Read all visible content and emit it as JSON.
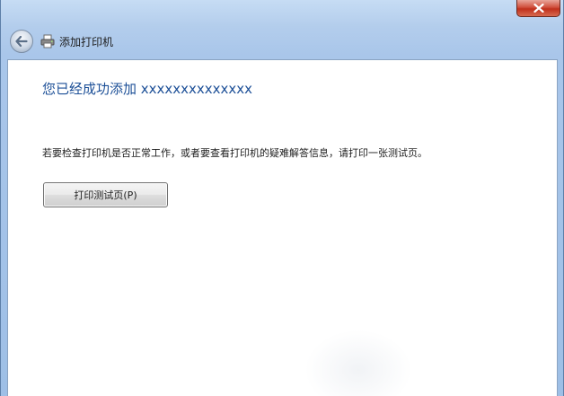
{
  "window": {
    "close_icon": "close-x-icon"
  },
  "nav": {
    "back_icon": "back-arrow-icon",
    "app_icon": "printer-icon",
    "title": "添加打印机"
  },
  "main": {
    "heading": "您已经成功添加 xxxxxxxxxxxxxx",
    "description": "若要检查打印机是否正常工作，或者要查看打印机的疑难解答信息，请打印一张测试页。",
    "print_test_page_button": "打印测试页(P)"
  },
  "colors": {
    "heading": "#1c4f97",
    "close_button": "#c0301c",
    "frame": "#a9c6ea"
  }
}
